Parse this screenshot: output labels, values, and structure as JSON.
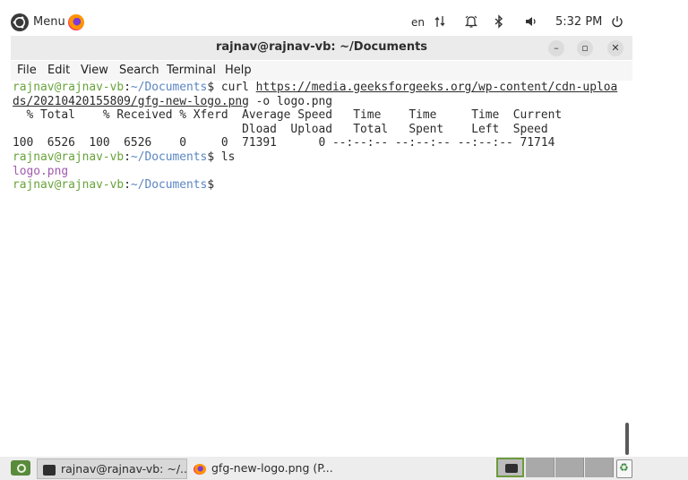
{
  "top_panel": {
    "menu_label": "Menu",
    "language": "en",
    "clock": "5:32 PM",
    "icons": [
      "ubuntu-logo",
      "firefox-icon",
      "network-icon",
      "notification-bell-icon",
      "bluetooth-icon",
      "volume-icon",
      "power-icon"
    ]
  },
  "window": {
    "title": "rajnav@rajnav-vb: ~/Documents",
    "buttons": {
      "minimize": "–",
      "maximize": "▫",
      "close": "✕"
    },
    "menu": [
      "File",
      "Edit",
      "View",
      "Search",
      "Terminal",
      "Help"
    ]
  },
  "terminal": {
    "prompt_user": "rajnav@rajnav-vb",
    "prompt_sep": ":",
    "prompt_path": "~/Documents",
    "prompt_end": "$",
    "cmd1": " curl ",
    "url_part1": "https://media.geeksforgeeks.org/wp-content/cdn-uploa",
    "url_part2": "ds/20210420155809/gfg-new-logo.png",
    "cmd1_tail": " -o logo.png",
    "curl_header1": "  % Total    % Received % Xferd  Average Speed   Time    Time     Time  Current",
    "curl_header2": "                                 Dload  Upload   Total   Spent    Left  Speed",
    "curl_progress": "100  6526  100  6526    0     0  71391      0 --:--:-- --:--:-- --:--:-- 71714",
    "cmd2": " ls",
    "ls_output": "logo.png"
  },
  "taskbar": {
    "tasks": [
      {
        "label": "rajnav@rajnav-vb: ~/...",
        "app": "terminal",
        "active": true
      },
      {
        "label": "gfg-new-logo.png (P...",
        "app": "firefox",
        "active": false
      }
    ],
    "workspaces": 4,
    "active_workspace": 1
  },
  "colors": {
    "prompt_user": "#67a33a",
    "prompt_path": "#5a85c2",
    "file_listing": "#a15ab0",
    "workspace_accent": "#6c9a3c"
  }
}
